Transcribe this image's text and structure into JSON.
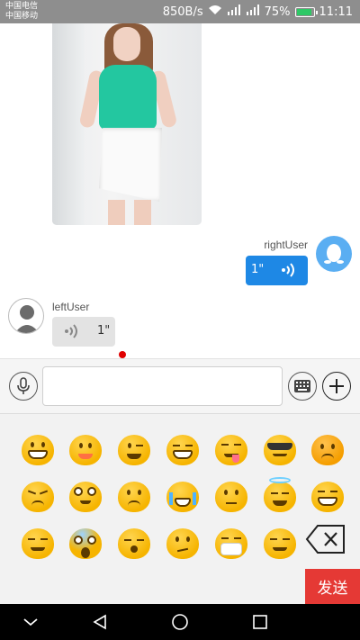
{
  "status_bar": {
    "carrier_1": "中国电信",
    "carrier_2": "中国移动",
    "speed": "850B/s",
    "battery": "75%",
    "time": "11:11"
  },
  "messages": [
    {
      "side": "left",
      "type": "image"
    },
    {
      "side": "right",
      "user": "rightUser",
      "type": "voice",
      "duration": "1\""
    },
    {
      "side": "left",
      "user": "leftUser",
      "type": "voice",
      "duration": "1\"",
      "unread": true
    }
  ],
  "input": {
    "placeholder": "",
    "value": ""
  },
  "emoji_panel": {
    "send_label": "发送",
    "emoji_names": [
      "grinning-face",
      "smiling-face",
      "winking-face",
      "grinning-sweat-face",
      "yum-face",
      "sunglasses-face",
      "angry-face",
      "persevering-face",
      "surprised-face",
      "frowning-face",
      "loudly-crying-face",
      "neutral-face",
      "halo-face",
      "big-grin-face",
      "relieved-face",
      "screaming-face",
      "sleepy-face",
      "confused-face",
      "mask-face",
      "blush-face"
    ]
  },
  "colors": {
    "status_bar": "#8e8e8e",
    "right_bubble": "#1e88e5",
    "left_bubble": "#e3e3e3",
    "send_button": "#e53935",
    "unread_dot": "#e00000"
  }
}
